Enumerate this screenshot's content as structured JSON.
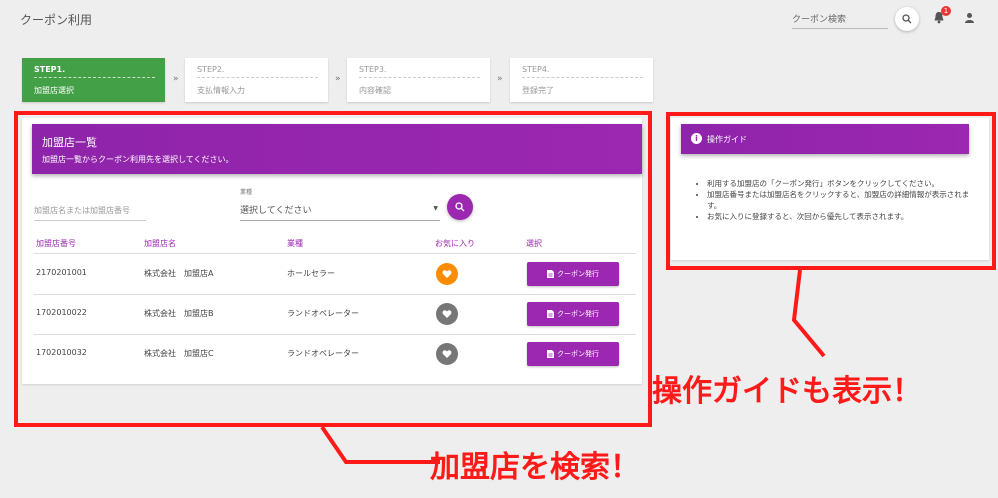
{
  "header": {
    "title": "クーポン利用",
    "search_placeholder": "クーポン検索",
    "notification_count": "1"
  },
  "steps": [
    {
      "num": "STEP1.",
      "label": "加盟店選択"
    },
    {
      "num": "STEP2.",
      "label": "支払情報入力"
    },
    {
      "num": "STEP3.",
      "label": "内容確認"
    },
    {
      "num": "STEP4.",
      "label": "登録完了"
    }
  ],
  "step_separator": "»",
  "list": {
    "title": "加盟店一覧",
    "subtitle": "加盟店一覧からクーポン利用先を選択してください。",
    "name_placeholder": "加盟店名または加盟店番号",
    "category_label": "業種",
    "category_value": "選択してください",
    "columns": [
      "加盟店番号",
      "加盟店名",
      "業種",
      "お気に入り",
      "選択"
    ],
    "rows": [
      {
        "number": "2170201001",
        "name": "株式会社　加盟店A",
        "category": "ホールセラー",
        "favorite": true,
        "button": "クーポン発行"
      },
      {
        "number": "1702010022",
        "name": "株式会社　加盟店B",
        "category": "ランドオペレーター",
        "favorite": false,
        "button": "クーポン発行"
      },
      {
        "number": "1702010032",
        "name": "株式会社　加盟店C",
        "category": "ランドオペレーター",
        "favorite": false,
        "button": "クーポン発行"
      }
    ]
  },
  "guide": {
    "title": "操作ガイド",
    "items": [
      "利用する加盟店の「クーポン発行」ボタンをクリックしてください。",
      "加盟店番号または加盟店名をクリックすると、加盟店の詳細情報が表示されます。",
      "お気に入りに登録すると、次回から優先して表示されます。"
    ]
  },
  "callouts": {
    "guide": "操作ガイドも表示！",
    "search": "加盟店を検索！"
  },
  "colors": {
    "accent": "#9c27b0",
    "active_step": "#43a047",
    "favorite": "#fb8c00",
    "callout": "#ff1a1a"
  }
}
